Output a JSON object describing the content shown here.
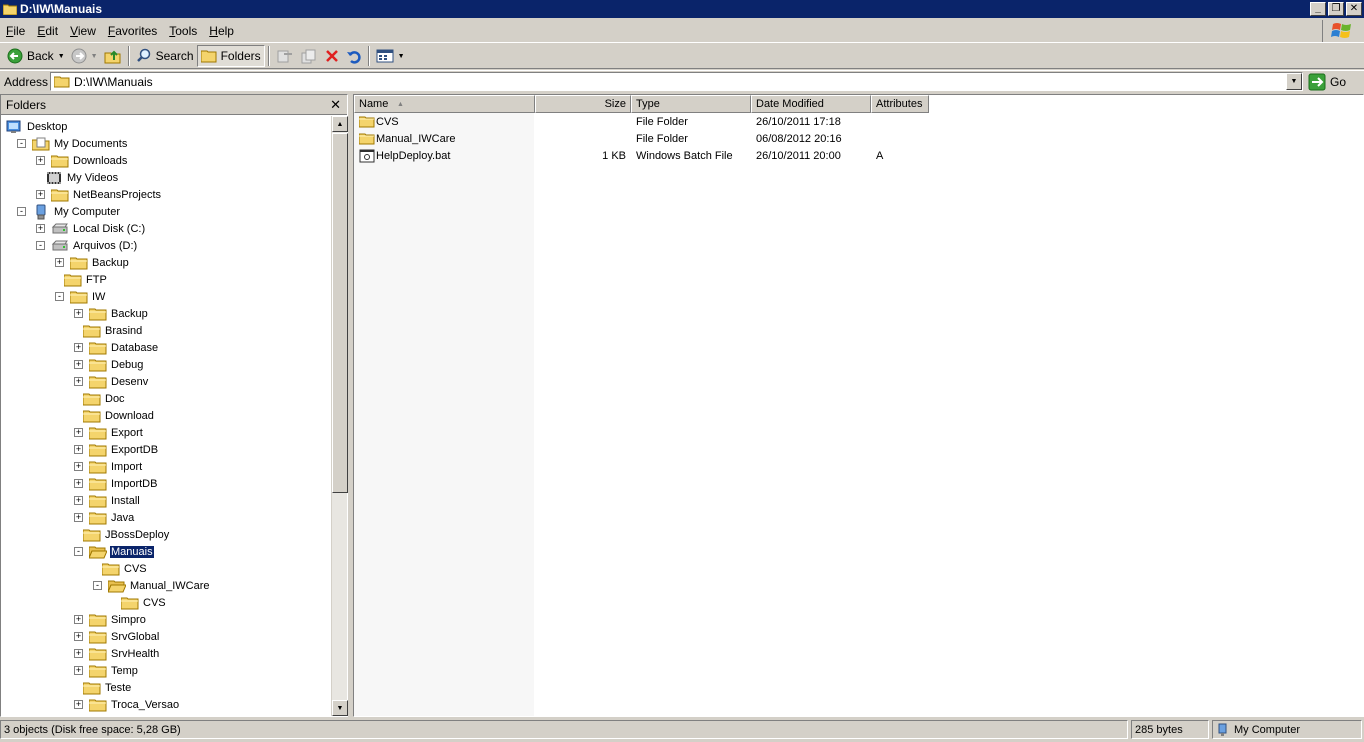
{
  "window": {
    "title": "D:\\IW\\Manuais"
  },
  "menu": {
    "items": [
      {
        "first": "F",
        "rest": "ile"
      },
      {
        "first": "E",
        "rest": "dit"
      },
      {
        "first": "V",
        "rest": "iew"
      },
      {
        "first": "F",
        "rest": "avorites"
      },
      {
        "first": "T",
        "rest": "ools"
      },
      {
        "first": "H",
        "rest": "elp"
      }
    ]
  },
  "toolbar": {
    "back_label": "Back",
    "search_label": "Search",
    "folders_label": "Folders"
  },
  "address": {
    "label": "Address",
    "value": "D:\\IW\\Manuais",
    "go_label": "Go"
  },
  "folders_pane": {
    "title": "Folders",
    "tree": [
      {
        "label": "Desktop"
      },
      {
        "label": "My Documents"
      },
      {
        "label": "Downloads"
      },
      {
        "label": "My Videos"
      },
      {
        "label": "NetBeansProjects"
      },
      {
        "label": "My Computer"
      },
      {
        "label": "Local Disk (C:)"
      },
      {
        "label": "Arquivos (D:)"
      },
      {
        "label": "Backup"
      },
      {
        "label": "FTP"
      },
      {
        "label": "IW"
      },
      {
        "label": "Backup"
      },
      {
        "label": "Brasind"
      },
      {
        "label": "Database"
      },
      {
        "label": "Debug"
      },
      {
        "label": "Desenv"
      },
      {
        "label": "Doc"
      },
      {
        "label": "Download"
      },
      {
        "label": "Export"
      },
      {
        "label": "ExportDB"
      },
      {
        "label": "Import"
      },
      {
        "label": "ImportDB"
      },
      {
        "label": "Install"
      },
      {
        "label": "Java"
      },
      {
        "label": "JBossDeploy"
      },
      {
        "label": "Manuais"
      },
      {
        "label": "CVS"
      },
      {
        "label": "Manual_IWCare"
      },
      {
        "label": "CVS"
      },
      {
        "label": "Simpro"
      },
      {
        "label": "SrvGlobal"
      },
      {
        "label": "SrvHealth"
      },
      {
        "label": "Temp"
      },
      {
        "label": "Teste"
      },
      {
        "label": "Troca_Versao"
      }
    ]
  },
  "file_list": {
    "columns": {
      "name": "Name",
      "size": "Size",
      "type": "Type",
      "date": "Date Modified",
      "attributes": "Attributes"
    },
    "rows": [
      {
        "name": "CVS",
        "size": "",
        "type": "File Folder",
        "date": "26/10/2011 17:18",
        "attributes": "",
        "icon": "folder-icon"
      },
      {
        "name": "Manual_IWCare",
        "size": "",
        "type": "File Folder",
        "date": "06/08/2012 20:16",
        "attributes": "",
        "icon": "folder-icon"
      },
      {
        "name": "HelpDeploy.bat",
        "size": "1 KB",
        "type": "Windows Batch File",
        "date": "26/10/2011 20:00",
        "attributes": "A",
        "icon": "batch-file-icon"
      }
    ]
  },
  "status": {
    "objects": "3 objects (Disk free space: 5,28 GB)",
    "size": "285 bytes",
    "zone": "My Computer"
  },
  "colors": {
    "titlebar": "#0a246a",
    "face": "#d4d0c8",
    "folder": "#f4d46c"
  }
}
